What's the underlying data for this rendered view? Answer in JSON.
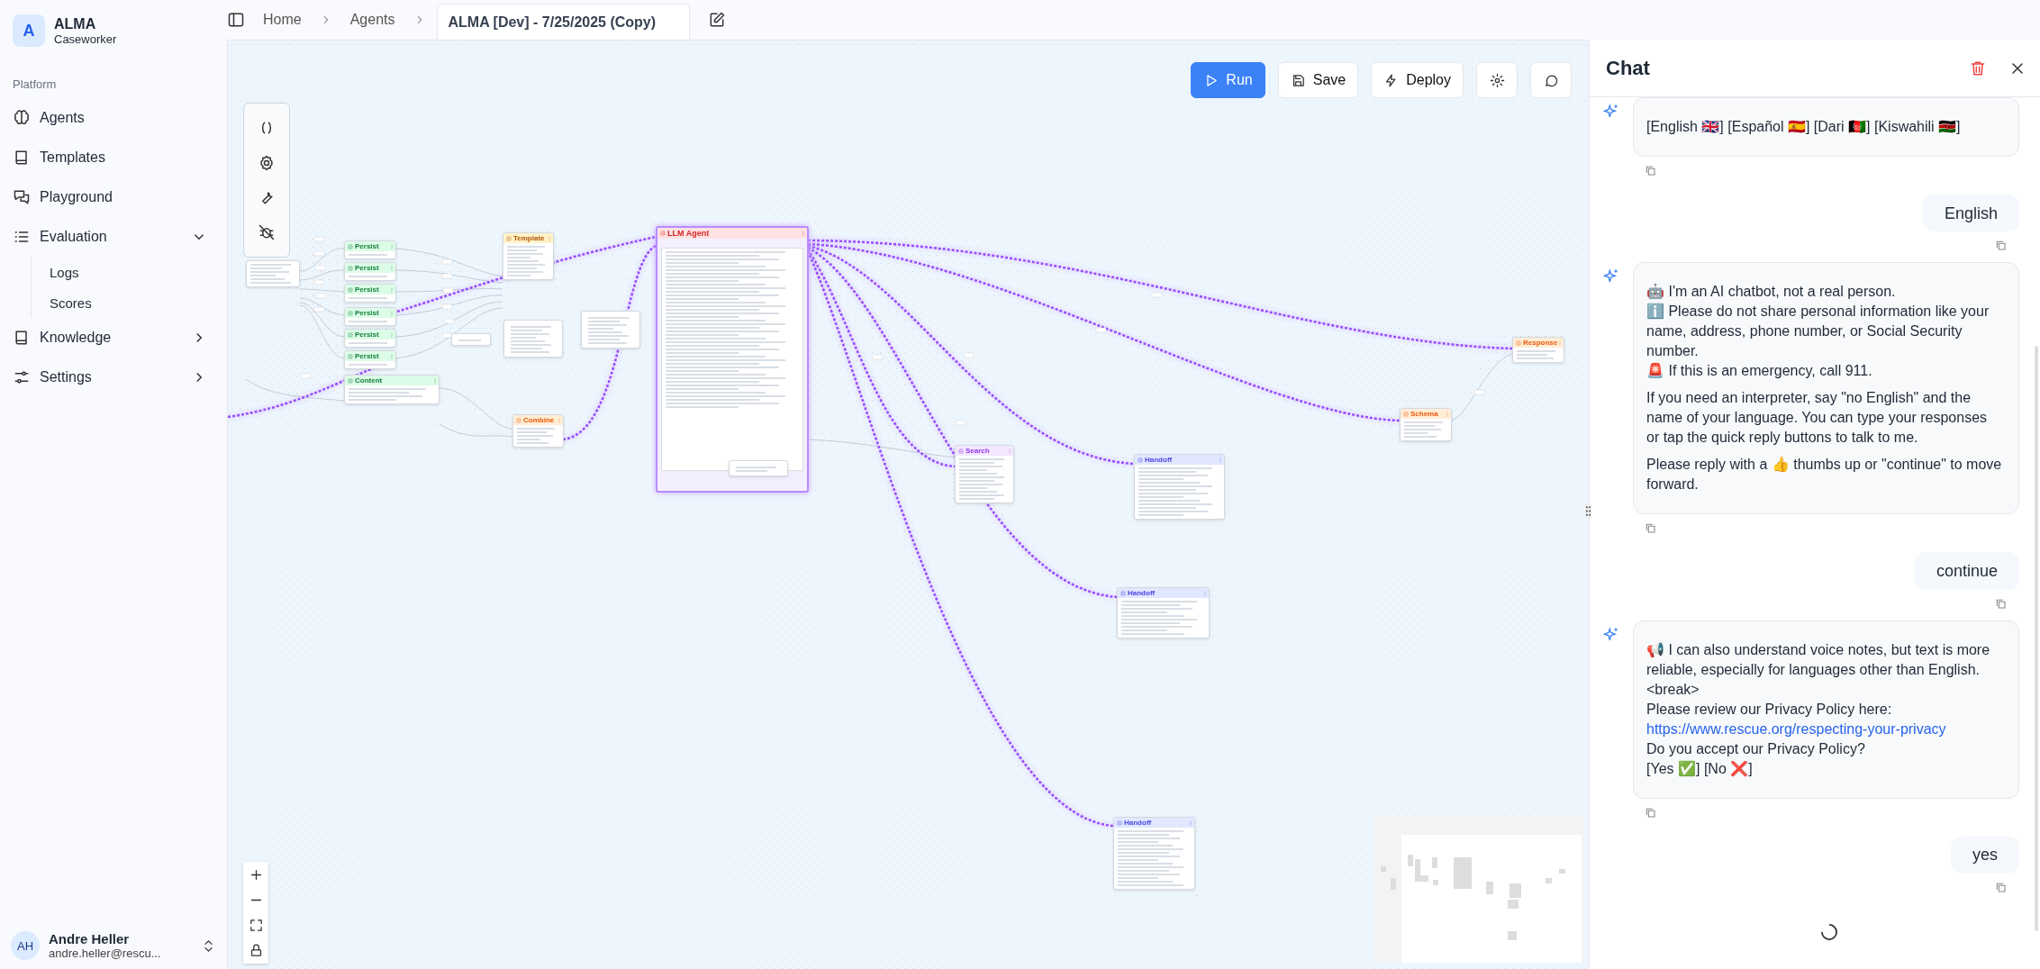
{
  "brand": {
    "logo_letter": "A",
    "name": "ALMA",
    "subtitle": "Caseworker"
  },
  "sidebar": {
    "section": "Platform",
    "items": [
      {
        "label": "Agents"
      },
      {
        "label": "Templates"
      },
      {
        "label": "Playground"
      },
      {
        "label": "Evaluation",
        "expanded": true,
        "children": [
          {
            "label": "Logs"
          },
          {
            "label": "Scores"
          }
        ]
      },
      {
        "label": "Knowledge",
        "expanded": false
      },
      {
        "label": "Settings",
        "expanded": false
      }
    ],
    "user": {
      "initials": "AH",
      "name": "Andre Heller",
      "email": "andre.heller@rescu..."
    }
  },
  "breadcrumb": [
    "Home",
    "Agents"
  ],
  "title": "ALMA [Dev] - 7/25/2025 (Copy)",
  "toolbar": [
    {
      "label": "Run",
      "primary": true
    },
    {
      "label": "Save",
      "primary": false
    },
    {
      "label": "Deploy",
      "primary": false
    },
    {
      "primary": false
    },
    {
      "primary": false
    }
  ],
  "nodes": [
    {
      "kind": "partial"
    },
    {
      "kind": "persist",
      "title": "Persist"
    },
    {
      "kind": "persist",
      "title": "Persist"
    },
    {
      "kind": "persist",
      "title": "Persist"
    },
    {
      "kind": "persist",
      "title": "Persist"
    },
    {
      "kind": "persist",
      "title": "Persist"
    },
    {
      "kind": "persist",
      "title": "Persist"
    },
    {
      "kind": "content",
      "title": "Content"
    },
    {
      "kind": "template",
      "title": "Template"
    },
    {
      "kind": "combine",
      "title": "Combine"
    },
    {
      "kind": "llm",
      "title": "LLM Agent"
    },
    {
      "kind": "search",
      "title": "Search"
    },
    {
      "kind": "handoff",
      "title": "Handoff"
    },
    {
      "kind": "handoff",
      "title": "Handoff"
    },
    {
      "kind": "handoff",
      "title": "Handoff"
    },
    {
      "kind": "schema",
      "title": "Schema"
    },
    {
      "kind": "response",
      "title": "Response"
    },
    {
      "kind": "note"
    },
    {
      "kind": "note"
    },
    {
      "kind": "note"
    },
    {
      "kind": "note"
    }
  ],
  "chat": {
    "title": "Chat",
    "messages": [
      {
        "kind": "bot",
        "paragraphs": [
          [
            "[English 🇬🇧] [Español 🇪🇸] [Dari 🇦🇫] [Kiswahili 🇰🇪]"
          ]
        ]
      },
      {
        "kind": "user",
        "text": "English"
      },
      {
        "kind": "bot",
        "paragraphs": [
          [
            "🤖 I'm an AI chatbot, not a real person.",
            "ℹ️ Please do not share personal information like your name, address, phone number, or Social Security number.",
            "🚨 If this is an emergency, call 911."
          ],
          [
            "If you need an interpreter, say \"no English\" and the name of your language. You can type your responses or tap the quick reply buttons to talk to me."
          ],
          [
            "Please reply with a 👍 thumbs up or \"continue\" to move forward."
          ]
        ]
      },
      {
        "kind": "user",
        "text": "continue"
      },
      {
        "kind": "bot",
        "paragraphs": [
          [
            "📢 I can also understand voice notes, but text is more reliable, especially for languages other than English.",
            "<break>",
            "Please review our Privacy Policy here:",
            {
              "link": "https://www.rescue.org/respecting-your-privacy"
            },
            "Do you accept our Privacy Policy?",
            "[Yes ✅] [No ❌]"
          ]
        ]
      },
      {
        "kind": "user",
        "text": "yes"
      }
    ],
    "loading": true
  }
}
